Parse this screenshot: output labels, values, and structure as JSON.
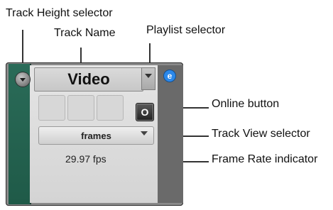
{
  "callouts": {
    "track_height": "Track Height selector",
    "track_name": "Track Name",
    "playlist": "Playlist selector",
    "online": "Online button",
    "track_view": "Track View selector",
    "frame_rate": "Frame Rate indicator"
  },
  "track": {
    "name": "Video",
    "online_label": "O",
    "view_label": "frames",
    "frame_rate": "29.97 fps",
    "badge": "e"
  },
  "icons": {
    "height": "chevron-down-icon",
    "playlist": "chevron-down-icon",
    "online": "online-icon",
    "view": "chevron-down-icon",
    "badge": "link-icon"
  },
  "colors": {
    "strip": "#236452",
    "badge": "#2b88ea"
  }
}
